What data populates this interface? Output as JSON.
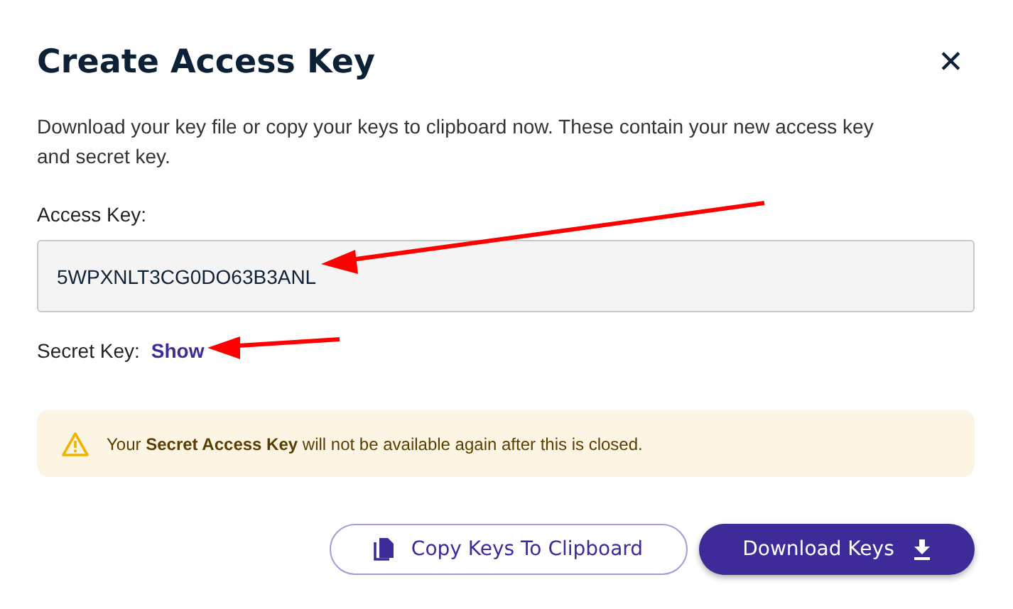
{
  "dialog": {
    "title": "Create Access Key",
    "close": "✕",
    "description": "Download your key file or copy your keys to clipboard now. These contain your new access key and secret key."
  },
  "access_key": {
    "label": "Access Key:",
    "value": "5WPXNLT3CG0DO63B3ANL"
  },
  "secret_key": {
    "label": "Secret Key:",
    "link": "Show"
  },
  "alert": {
    "text": "Your **Secret Access Key** will not be available again after this is closed."
  },
  "buttons": [
    {
      "label": "Copy Keys To Clipboard",
      "kind": "outline"
    },
    {
      "label": "Download Keys",
      "kind": "primary"
    }
  ]
}
